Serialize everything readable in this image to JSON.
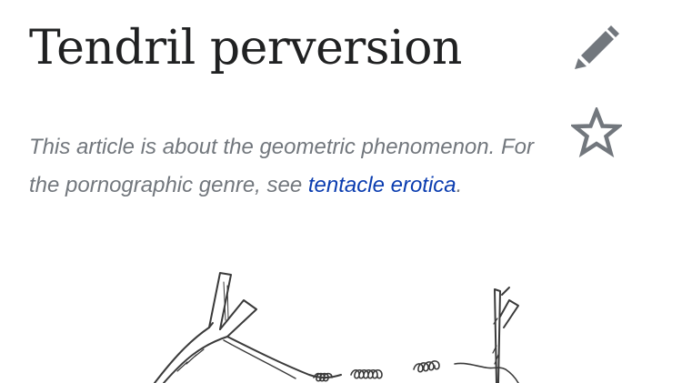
{
  "page": {
    "title": "Tendril perversion"
  },
  "actions": {
    "edit_icon": "pencil-icon",
    "watch_icon": "star-icon"
  },
  "hatnote": {
    "text_before": "This article is about the geometric phenomenon. For the pornographic genre, see ",
    "link_text": "tentacle erotica",
    "text_after": "."
  },
  "figure": {
    "subject": "tendril-illustration"
  },
  "colors": {
    "title": "#202122",
    "hatnote": "#72777d",
    "link": "#0b3db0",
    "icon": "#72777d"
  }
}
